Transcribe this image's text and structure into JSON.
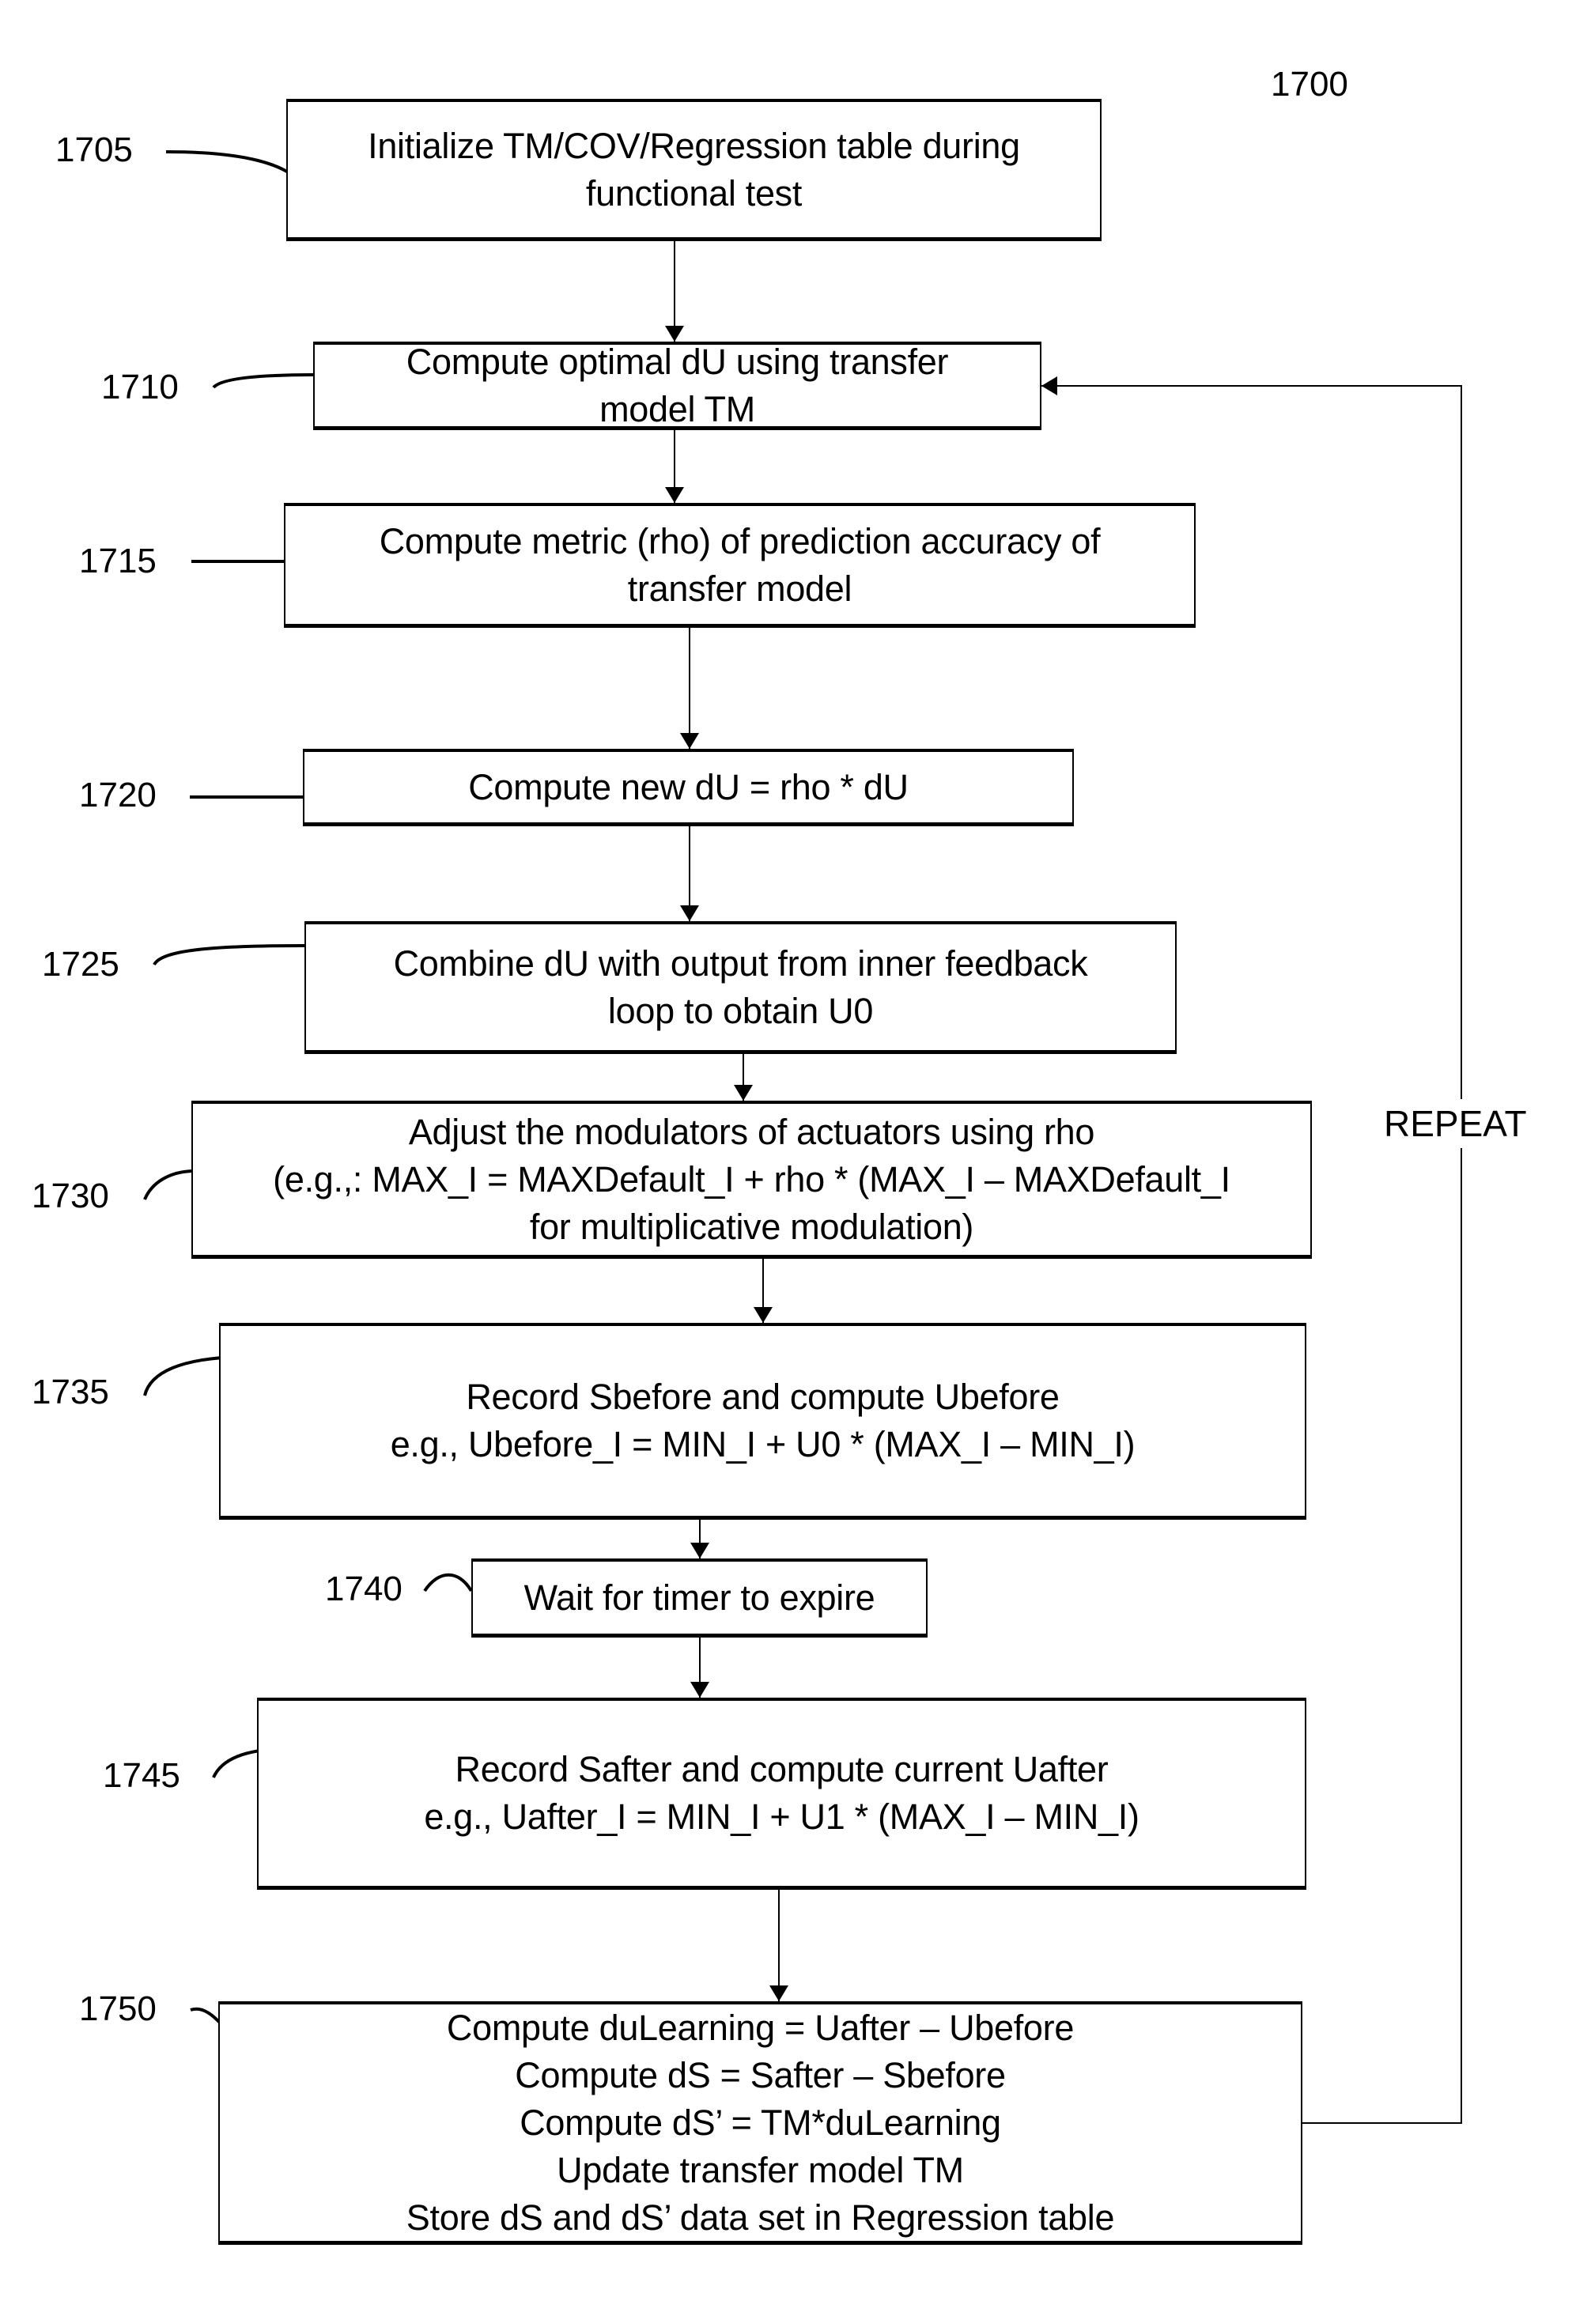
{
  "figure": {
    "number": "1700",
    "loop_label": "REPEAT"
  },
  "steps": [
    {
      "ref": "1705",
      "lines": [
        "Initialize TM/COV/Regression table during",
        "functional test"
      ]
    },
    {
      "ref": "1710",
      "lines": [
        "Compute optimal dU using transfer",
        "model TM"
      ]
    },
    {
      "ref": "1715",
      "lines": [
        "Compute metric (rho) of prediction accuracy of",
        "transfer model"
      ]
    },
    {
      "ref": "1720",
      "lines": [
        "Compute new dU = rho * dU"
      ]
    },
    {
      "ref": "1725",
      "lines": [
        "Combine dU with output from inner feedback",
        "loop to obtain U0"
      ]
    },
    {
      "ref": "1730",
      "lines": [
        "Adjust the modulators of actuators using rho",
        "(e.g.,: MAX_I = MAXDefault_I + rho * (MAX_I – MAXDefault_I",
        "for multiplicative modulation)"
      ]
    },
    {
      "ref": "1735",
      "lines": [
        "Record Sbefore and compute Ubefore",
        "e.g., Ubefore_I = MIN_I + U0 * (MAX_I – MIN_I)"
      ]
    },
    {
      "ref": "1740",
      "lines": [
        "Wait for timer to expire"
      ]
    },
    {
      "ref": "1745",
      "lines": [
        "Record Safter and compute current Uafter",
        "e.g., Uafter_I = MIN_I + U1 * (MAX_I – MIN_I)"
      ]
    },
    {
      "ref": "1750",
      "lines": [
        "Compute duLearning = Uafter – Ubefore",
        "Compute dS = Safter – Sbefore",
        "Compute dS’ = TM*duLearning",
        "Update transfer model TM",
        "Store dS and dS’ data set in Regression table"
      ]
    }
  ]
}
